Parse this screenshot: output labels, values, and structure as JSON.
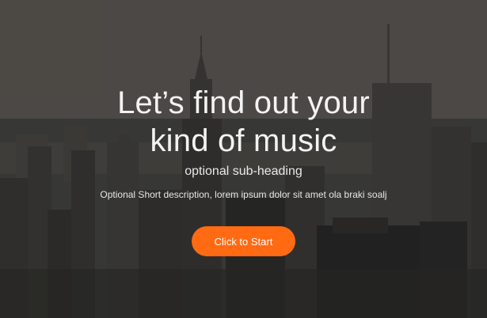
{
  "hero": {
    "headline_line1": "Let’s find out your",
    "headline_line2": "kind of music",
    "subheading": "optional sub-heading",
    "description": "Optional Short description, lorem ipsum dolor sit amet ola braki soalj",
    "cta_label": "Click to Start",
    "background_image": "city-skyline"
  },
  "colors": {
    "accent": "#ff6a13",
    "text": "#f3f3f3"
  }
}
